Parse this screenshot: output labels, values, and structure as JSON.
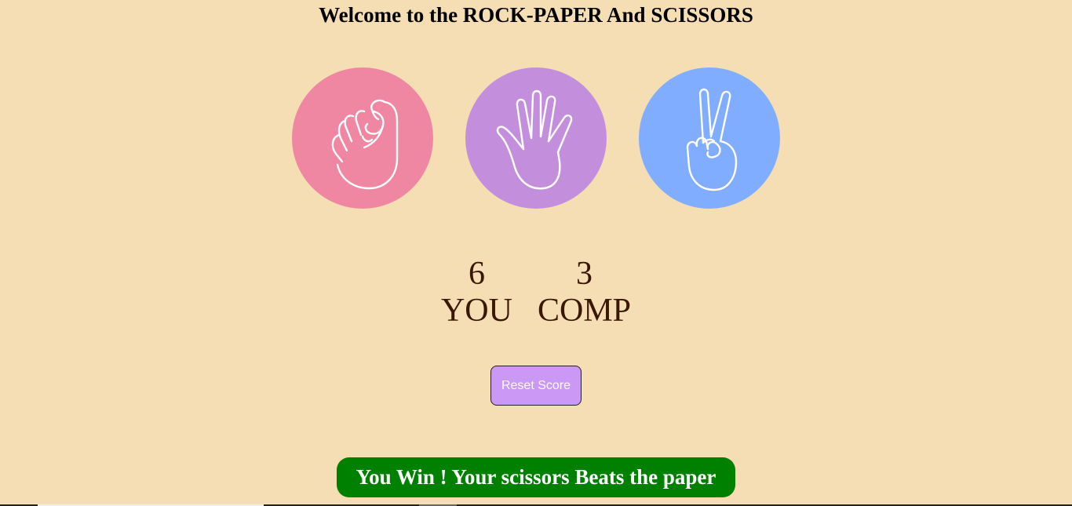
{
  "title": "Welcome to the ROCK-PAPER And SCISSORS",
  "choices": [
    {
      "id": "rock",
      "icon": "fist-icon",
      "color": "#f087a2"
    },
    {
      "id": "paper",
      "icon": "open-hand-icon",
      "color": "#c38fdd"
    },
    {
      "id": "scissors",
      "icon": "peace-hand-icon",
      "color": "#80adff"
    }
  ],
  "score": {
    "user_score": "6",
    "user_label": "YOU",
    "comp_score": "3",
    "comp_label": "COMP"
  },
  "reset_button": {
    "label": "Reset Score",
    "color": "#cb98f5"
  },
  "message": {
    "text": "You Win ! Your scissors Beats the paper",
    "color": "#008000"
  }
}
